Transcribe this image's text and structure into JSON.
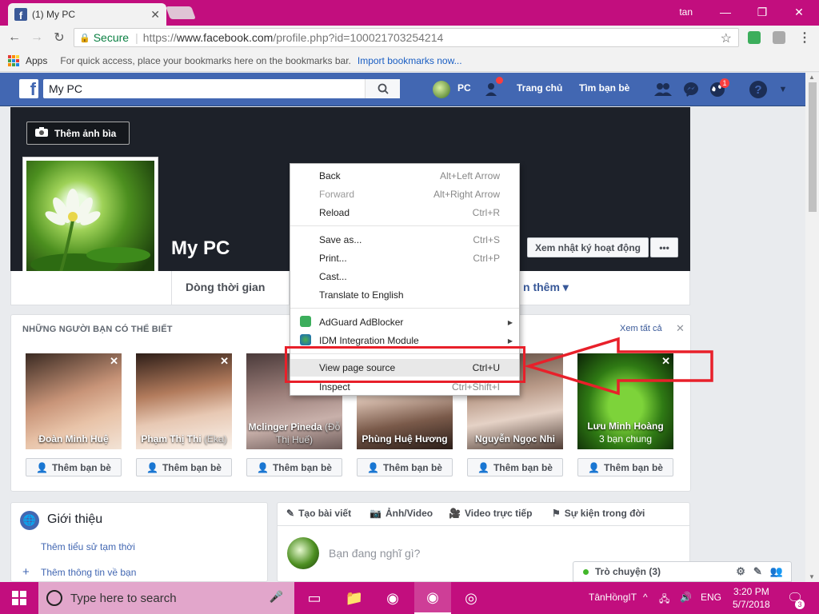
{
  "browser": {
    "tab_title": "(1) My PC",
    "user": "tan",
    "secure_label": "Secure",
    "url_prefix": "https://",
    "url_host": "www.facebook.com",
    "url_path": "/profile.php?id=100021703254214",
    "bookmarks": {
      "apps_label": "Apps",
      "hint": "For quick access, place your bookmarks here on the bookmarks bar.",
      "import_link": "Import bookmarks now..."
    }
  },
  "facebook": {
    "search_value": "My PC",
    "nav_user": "PC",
    "nav_home": "Trang chủ",
    "nav_find_friends": "Tìm bạn bè",
    "notif_badge": "1",
    "brand_color": "#4267b2",
    "cover_button": "Thêm ảnh bìa",
    "profile_name": "My PC",
    "activity_button": "Xem nhật ký hoạt động",
    "more_button": "•••",
    "tabs": {
      "timeline": "Dòng thời gian",
      "more": "n thêm ▾"
    },
    "pymk": {
      "title": "NHỮNG NGƯỜI BẠN CÓ THỂ BIẾT",
      "see_all": "Xem tất cả",
      "add_label": "Thêm bạn bè",
      "friends": [
        {
          "name": "Đoàn Minh Huệ",
          "extra": ""
        },
        {
          "name": "Phạm Thị Thi",
          "extra": "(Eka)"
        },
        {
          "name": "Mclinger Pineda",
          "extra": "(Đỗ Thị Huế)"
        },
        {
          "name": "Phùng Huệ Hương",
          "extra": ""
        },
        {
          "name": "Nguyễn Ngọc Nhi",
          "extra": ""
        },
        {
          "name": "Lưu Minh Hoàng",
          "extra": "3 bạn chung"
        }
      ]
    },
    "intro": {
      "title": "Giới thiệu",
      "link1": "Thêm tiểu sử tạm thời",
      "link2": "Thêm thông tin về bạn"
    },
    "composer": {
      "tab_post": "Tạo bài viết",
      "tab_photo": "Ảnh/Video",
      "tab_live": "Video trực tiếp",
      "tab_event": "Sự kiện trong đời",
      "placeholder": "Bạn đang nghĩ gì?"
    },
    "chat": {
      "label": "Trò chuyện (3)"
    }
  },
  "context_menu": {
    "items": [
      {
        "label": "Back",
        "shortcut": "Alt+Left Arrow",
        "disabled": false
      },
      {
        "label": "Forward",
        "shortcut": "Alt+Right Arrow",
        "disabled": true
      },
      {
        "label": "Reload",
        "shortcut": "Ctrl+R",
        "disabled": false
      },
      {
        "label": "Save as...",
        "shortcut": "Ctrl+S",
        "disabled": false
      },
      {
        "label": "Print...",
        "shortcut": "Ctrl+P",
        "disabled": false
      },
      {
        "label": "Cast...",
        "shortcut": "",
        "disabled": false
      },
      {
        "label": "Translate to English",
        "shortcut": "",
        "disabled": false
      },
      {
        "label": "AdGuard AdBlocker",
        "shortcut": "",
        "disabled": false
      },
      {
        "label": "IDM Integration Module",
        "shortcut": "",
        "disabled": false
      },
      {
        "label": "View page source",
        "shortcut": "Ctrl+U",
        "disabled": false
      },
      {
        "label": "Inspect",
        "shortcut": "Ctrl+Shift+I",
        "disabled": false
      }
    ],
    "highlight_color": "#e8202a"
  },
  "taskbar": {
    "search_placeholder": "Type here to search",
    "tray_user": "TânHồngIT",
    "language": "ENG",
    "time": "3:20 PM",
    "date": "5/7/2018",
    "notif_count": "3",
    "accent_color": "#c20e7e"
  }
}
